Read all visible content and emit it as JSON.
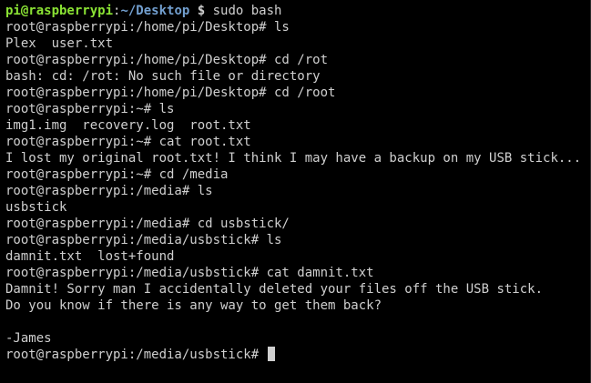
{
  "prompt_first": {
    "user_host": "pi@raspberrypi",
    "sep": ":",
    "path": "~/Desktop",
    "dollar": " $",
    "command": " sudo bash"
  },
  "lines": [
    "root@raspberrypi:/home/pi/Desktop# ls",
    "Plex  user.txt",
    "root@raspberrypi:/home/pi/Desktop# cd /rot",
    "bash: cd: /rot: No such file or directory",
    "root@raspberrypi:/home/pi/Desktop# cd /root",
    "root@raspberrypi:~# ls",
    "img1.img  recovery.log  root.txt",
    "root@raspberrypi:~# cat root.txt",
    "I lost my original root.txt! I think I may have a backup on my USB stick...",
    "root@raspberrypi:~# cd /media",
    "root@raspberrypi:/media# ls",
    "usbstick",
    "root@raspberrypi:/media# cd usbstick/",
    "root@raspberrypi:/media/usbstick# ls",
    "damnit.txt  lost+found",
    "root@raspberrypi:/media/usbstick# cat damnit.txt",
    "Damnit! Sorry man I accidentally deleted your files off the USB stick.",
    "Do you know if there is any way to get them back?",
    "",
    "-James"
  ],
  "final_prompt": "root@raspberrypi:/media/usbstick# "
}
